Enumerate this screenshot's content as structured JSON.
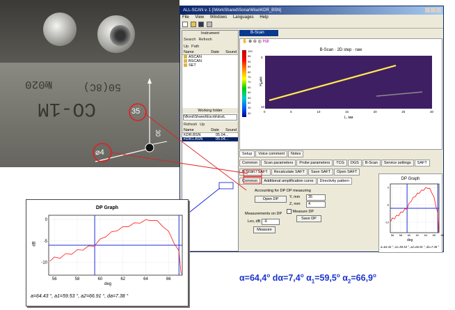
{
  "photo": {
    "etched_top": "CO-1M",
    "etched_code": "50(8C)",
    "etched_num": "№020",
    "label_35": "35",
    "label_phi4": "⌀4",
    "label_30": "30"
  },
  "window": {
    "title": "ALL-SCAN v. 1 [\\WorkShared\\SonarWise\\KDR_BSN]",
    "menu": [
      "File",
      "View",
      "Windows",
      "Languages",
      "Help"
    ],
    "instrument_title": "Instrument",
    "search_label": "Search",
    "refresh_label": "Refresh",
    "up_label": "Up",
    "path_label": "Path",
    "file_headers": [
      "Name",
      "Date",
      "Sound"
    ],
    "folders": [
      "ASCAN",
      "BSCAN",
      "SET"
    ],
    "working_folder_title": "Working folder",
    "working_folder_path": "\\\\Bond\\Shared\\Escrib\\dra\\L",
    "refresh2_label": "Refresh",
    "up2_label": "Up",
    "files": [
      {
        "name": "KDR.BSN",
        "date": "05.04..."
      },
      {
        "name": "KDR1.BSN",
        "date": "05.04..."
      }
    ],
    "tab_bscan": "B-Scan",
    "hdr_label": "Hdr",
    "bscan_title": "B-Scan · 2D step · raw",
    "y_axis_label": "H, мм",
    "x_axis_label": "L, мм",
    "colorbar_ticks": [
      "100",
      "95",
      "90",
      "85",
      "80",
      "75",
      "70",
      "65",
      "60",
      "55",
      "50",
      "45",
      "40"
    ],
    "bscan_xticks": [
      "0",
      "5",
      "10",
      "15",
      "20",
      "25",
      "30"
    ],
    "bscan_yticks": [
      "0",
      "5",
      "10"
    ],
    "bottom_tabs": [
      "Setup",
      "Voice comment",
      "Notes"
    ],
    "setup_tabs": [
      "Common",
      "Scan parameters",
      "Probe parameters",
      "TCG",
      "DGS",
      "B-Scan",
      "Service settings",
      "SAFT"
    ],
    "saft_tabs": [
      "B-Scan / SAFT",
      "Recalculate SAFT",
      "Save SAFT",
      "Open SAFT"
    ],
    "sub_tabs": [
      "Common",
      "Additional amplification curve",
      "Directivity pattern"
    ],
    "accounting_label": "Accounting for DP",
    "open_dp": "Open DP",
    "dp_measuring_label": "DP measuring",
    "ymm_label": "Y, mm",
    "ymm_value": "35",
    "zmm_label": "Z, mm",
    "zmm_value": "4",
    "measure_dp_label": "Measure DP",
    "save_dp": "Save DP",
    "meas_on_dp_label": "Measurements on DP",
    "lev_label": "Lev, dB",
    "lev_value": "-6",
    "measure_btn": "Measure",
    "small_graph_title": "DP Graph",
    "small_yticks": [
      "0",
      "-5",
      "-10"
    ],
    "small_xticks": [
      "56",
      "58",
      "60",
      "62",
      "64",
      "66",
      "68"
    ],
    "small_xlabel": "deg",
    "small_footer": "a=64.43 °,  a1=59.53 °,  a2=66.91 °,  da=7.38 °"
  },
  "big_graph": {
    "title": "DP Graph",
    "yticks": [
      "0",
      "-5",
      "-10"
    ],
    "xticks": [
      "56",
      "58",
      "60",
      "62",
      "64",
      "66"
    ],
    "ylabel": "dB",
    "xlabel": "deg",
    "footer": "a=64.43 °,  a1=59.53 °,  a2=66.91 °,  da=7.38 °"
  },
  "chart_data": {
    "type": "line",
    "title": "DP Graph",
    "xlabel": "deg",
    "ylabel": "dB",
    "xlim": [
      55.5,
      67.2
    ],
    "ylim": [
      -13,
      1
    ],
    "level_line": -6,
    "markers_x": [
      59.53,
      66.91
    ],
    "x": [
      55.6,
      56.0,
      56.5,
      57.0,
      57.5,
      58.0,
      58.5,
      59.0,
      59.5,
      60.0,
      60.5,
      61.0,
      61.5,
      62.0,
      62.5,
      63.0,
      63.5,
      64.0,
      64.43,
      65.0,
      65.5,
      66.0,
      66.5,
      66.9,
      67.1
    ],
    "y": [
      -9.5,
      -9.0,
      -8.8,
      -8.2,
      -7.9,
      -7.3,
      -6.9,
      -6.4,
      -6.0,
      -4.8,
      -3.8,
      -3.1,
      -2.4,
      -1.9,
      -1.4,
      -1.0,
      -0.6,
      -0.3,
      0.0,
      -0.5,
      -1.4,
      -3.0,
      -5.4,
      -7.5,
      -12.5
    ]
  },
  "formula": {
    "alpha": "α=64,4",
    "dalpha": "dα=7,4",
    "alpha1": "α",
    "alpha1_val": "=59,5",
    "alpha2": "α",
    "alpha2_val": "=66,9",
    "deg": "o",
    "sub1": "1",
    "sub2": "2"
  },
  "colors": {
    "annotation": "#e02020",
    "formula": "#1a33cc",
    "trace": "#ff1010",
    "marker": "#1e2bd8"
  }
}
